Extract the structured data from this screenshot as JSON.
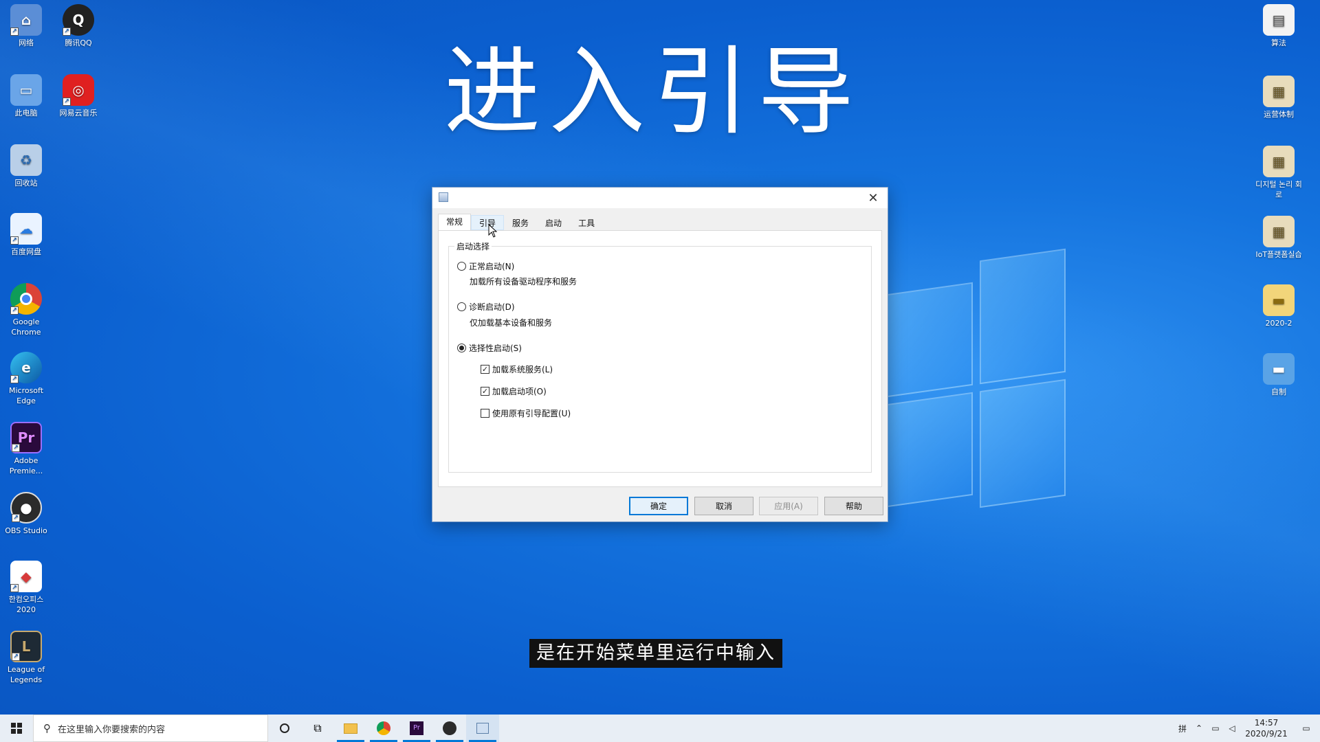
{
  "overlay": {
    "title": "进入引导",
    "subtitle": "是在开始菜单里运行中输入"
  },
  "desktop_icons_left": [
    {
      "label": "网络",
      "icon": "network-icon"
    },
    {
      "label": "腾讯QQ",
      "icon": "qq-icon"
    },
    {
      "label": "此电脑",
      "icon": "this-pc-icon"
    },
    {
      "label": "网易云音乐",
      "icon": "netease-music-icon"
    },
    {
      "label": "回收站",
      "icon": "recycle-bin-icon"
    },
    {
      "label": "百度网盘",
      "icon": "baidu-netdisk-icon"
    },
    {
      "label": "Google Chrome",
      "icon": "chrome-icon"
    },
    {
      "label": "Microsoft Edge",
      "icon": "edge-icon"
    },
    {
      "label": "Adobe Premie...",
      "icon": "premiere-icon"
    },
    {
      "label": "OBS Studio",
      "icon": "obs-icon"
    },
    {
      "label": "한컴오피스 2020",
      "icon": "hancom-office-icon"
    },
    {
      "label": "League of Legends",
      "icon": "league-icon"
    }
  ],
  "desktop_icons_right": [
    {
      "label": "算法",
      "icon": "document-icon"
    },
    {
      "label": "运营体制",
      "icon": "archive-icon"
    },
    {
      "label": "디지털 논리 회로",
      "icon": "archive-icon"
    },
    {
      "label": "IoT플랫폼실습",
      "icon": "archive-icon"
    },
    {
      "label": "2020-2",
      "icon": "folder-icon"
    },
    {
      "label": "自制",
      "icon": "folder-icon"
    }
  ],
  "dialog": {
    "tabs": [
      "常规",
      "引导",
      "服务",
      "启动",
      "工具"
    ],
    "active_tab": "常规",
    "group_label": "启动选择",
    "options": {
      "normal": {
        "label": "正常启动(N)",
        "desc": "加载所有设备驱动程序和服务",
        "selected": false
      },
      "diagnostic": {
        "label": "诊断启动(D)",
        "desc": "仅加载基本设备和服务",
        "selected": false
      },
      "selective": {
        "label": "选择性启动(S)",
        "selected": true
      }
    },
    "checks": {
      "system_services": {
        "label": "加载系统服务(L)",
        "checked": true
      },
      "startup_items": {
        "label": "加载启动项(O)",
        "checked": true
      },
      "original_boot": {
        "label": "使用原有引导配置(U)",
        "checked": false
      }
    },
    "buttons": {
      "ok": "确定",
      "cancel": "取消",
      "apply": "应用(A)",
      "help": "帮助"
    }
  },
  "taskbar": {
    "search_placeholder": "在这里输入你要搜索的内容",
    "time": "14:57",
    "date": "2020/9/21"
  }
}
